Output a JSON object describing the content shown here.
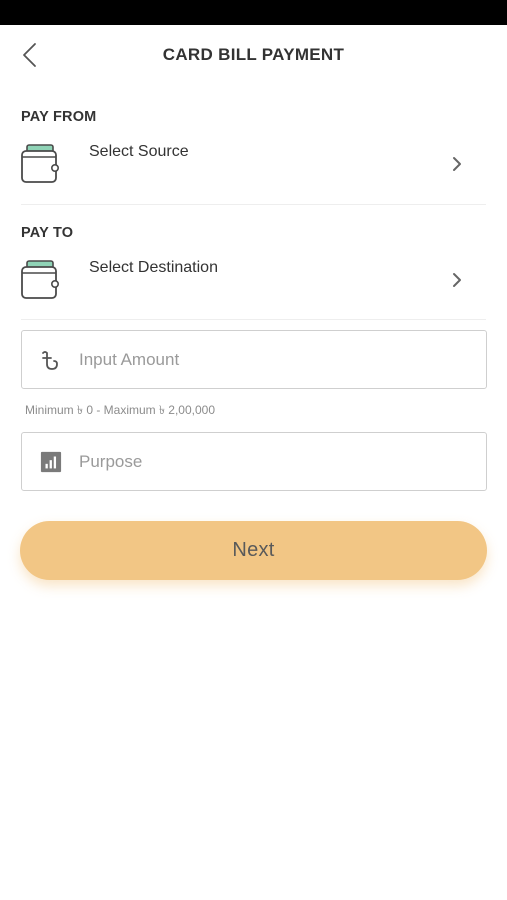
{
  "header": {
    "title": "CARD BILL PAYMENT",
    "back_icon": "chevron-left-icon"
  },
  "pay_from": {
    "label": "PAY FROM",
    "text": "Select Source",
    "icon": "wallet-icon"
  },
  "pay_to": {
    "label": "PAY TO",
    "text": "Select Destination",
    "icon": "wallet-icon"
  },
  "amount": {
    "placeholder": "Input Amount",
    "value": "",
    "icon": "taka-icon",
    "hint": "Minimum ৳ 0 - Maximum ৳ 2,00,000"
  },
  "purpose": {
    "placeholder": "Purpose",
    "value": "",
    "icon": "chart-icon"
  },
  "next_button": {
    "label": "Next"
  },
  "colors": {
    "accent": "#f2c685",
    "wallet_green": "#8fd3b6",
    "text": "#333333",
    "placeholder": "#9a9a9a"
  }
}
